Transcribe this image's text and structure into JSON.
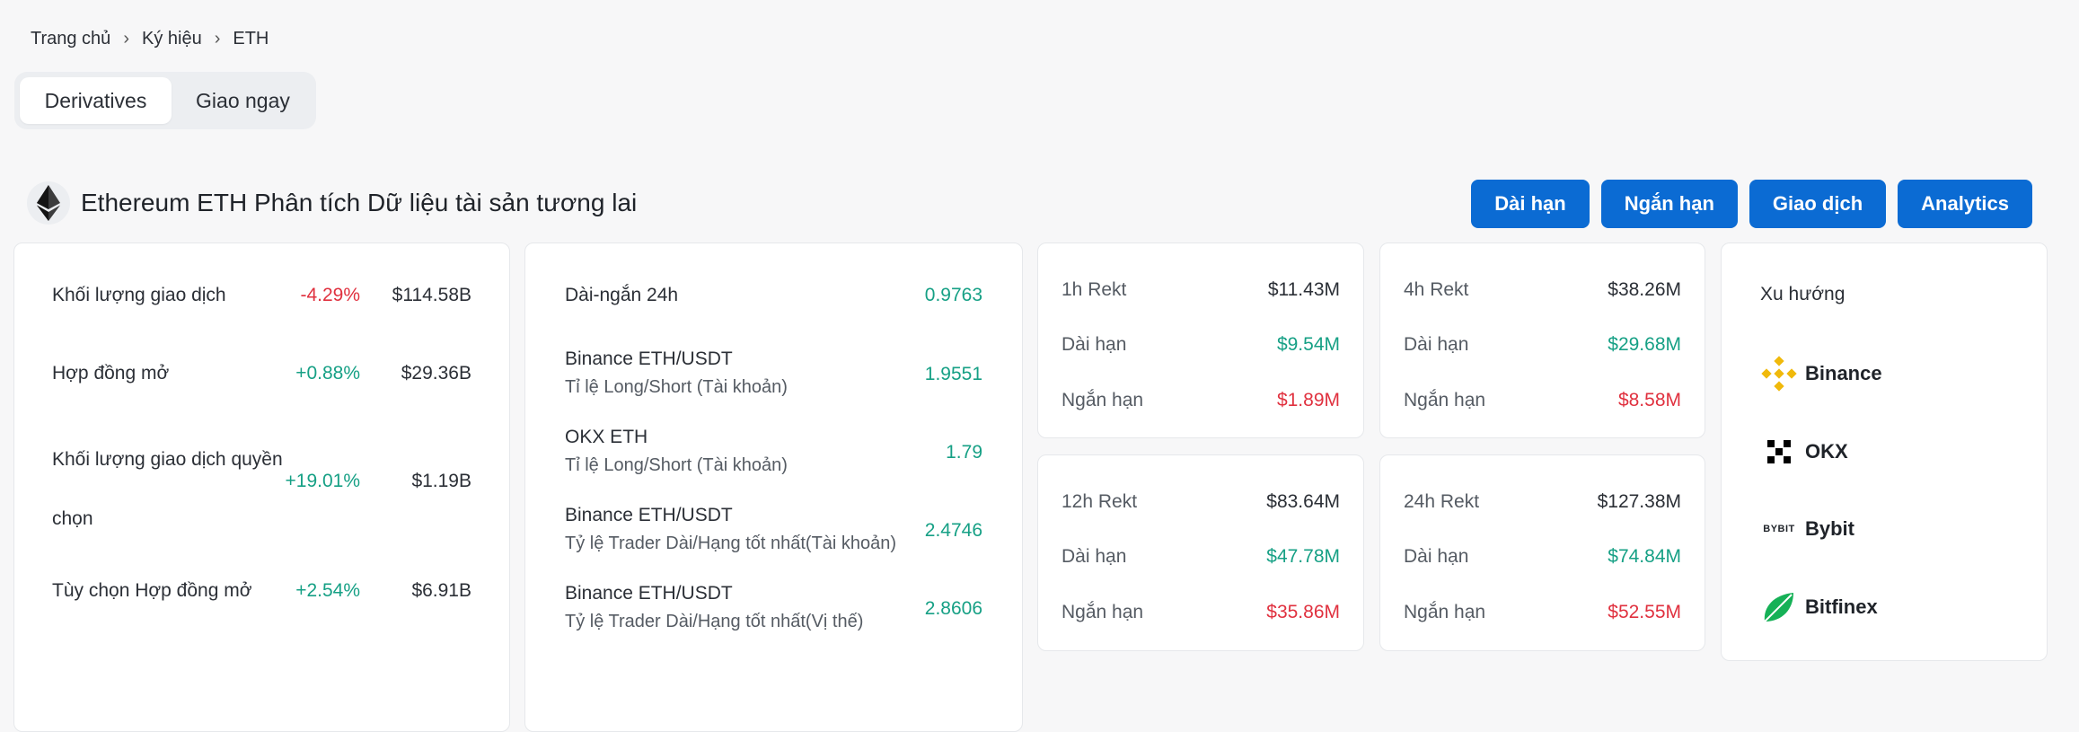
{
  "breadcrumb": {
    "home": "Trang chủ",
    "symbols": "Ký hiệu",
    "current": "ETH",
    "sep": "›"
  },
  "tabs": {
    "derivatives": "Derivatives",
    "spot": "Giao ngay"
  },
  "title": "Ethereum ETH Phân tích Dữ liệu tài sản tương lai",
  "actions": {
    "long": "Dài hạn",
    "short": "Ngắn hạn",
    "trade": "Giao dịch",
    "analytics": "Analytics"
  },
  "market": {
    "rows": [
      {
        "label": "Khối lượng giao dịch",
        "change": "-4.29%",
        "value": "$114.58B"
      },
      {
        "label": "Hợp đồng mở",
        "change": "+0.88%",
        "value": "$29.36B"
      },
      {
        "label_line1": "Khối lượng giao dịch quyền",
        "label_line2": "chọn",
        "change": "+19.01%",
        "value": "$1.19B"
      },
      {
        "label": "Tùy chọn Hợp đồng mở",
        "change": "+2.54%",
        "value": "$6.91B"
      }
    ]
  },
  "long_short": {
    "rows": [
      {
        "line1": "Dài-ngắn 24h",
        "ratio": "0.9763"
      },
      {
        "line1": "Binance ETH/USDT",
        "line2": "Tỉ lệ Long/Short (Tài khoản)",
        "ratio": "1.9551"
      },
      {
        "line1": "OKX ETH",
        "line2": "Tỉ lệ Long/Short (Tài khoản)",
        "ratio": "1.79"
      },
      {
        "line1": "Binance ETH/USDT",
        "line2": "Tỷ lệ Trader Dài/Hạng tốt nhất(Tài khoản)",
        "ratio": "2.4746"
      },
      {
        "line1": "Binance ETH/USDT",
        "line2": "Tỷ lệ Trader Dài/Hạng tốt nhất(Vị thế)",
        "ratio": "2.8606"
      }
    ]
  },
  "rekt": [
    {
      "period": "1h Rekt",
      "total": "$11.43M",
      "long_label": "Dài hạn",
      "long": "$9.54M",
      "short_label": "Ngắn hạn",
      "short": "$1.89M"
    },
    {
      "period": "4h Rekt",
      "total": "$38.26M",
      "long_label": "Dài hạn",
      "long": "$29.68M",
      "short_label": "Ngắn hạn",
      "short": "$8.58M"
    },
    {
      "period": "12h Rekt",
      "total": "$83.64M",
      "long_label": "Dài hạn",
      "long": "$47.78M",
      "short_label": "Ngắn hạn",
      "short": "$35.86M"
    },
    {
      "period": "24h Rekt",
      "total": "$127.38M",
      "long_label": "Dài hạn",
      "long": "$74.84M",
      "short_label": "Ngắn hạn",
      "short": "$52.55M"
    }
  ],
  "trend": {
    "title": "Xu hướng",
    "exchanges": [
      {
        "name": "Binance",
        "icon": "binance-icon"
      },
      {
        "name": "OKX",
        "icon": "okx-icon"
      },
      {
        "name": "Bybit",
        "icon": "bybit-icon",
        "icon_text": "BYBIT"
      },
      {
        "name": "Bitfinex",
        "icon": "bitfinex-icon"
      }
    ]
  },
  "colors": {
    "accent": "#0b6bd3",
    "positive": "#16a085",
    "negative": "#e0313f",
    "binance": "#f0b90b",
    "bitfinex": "#16b157"
  }
}
